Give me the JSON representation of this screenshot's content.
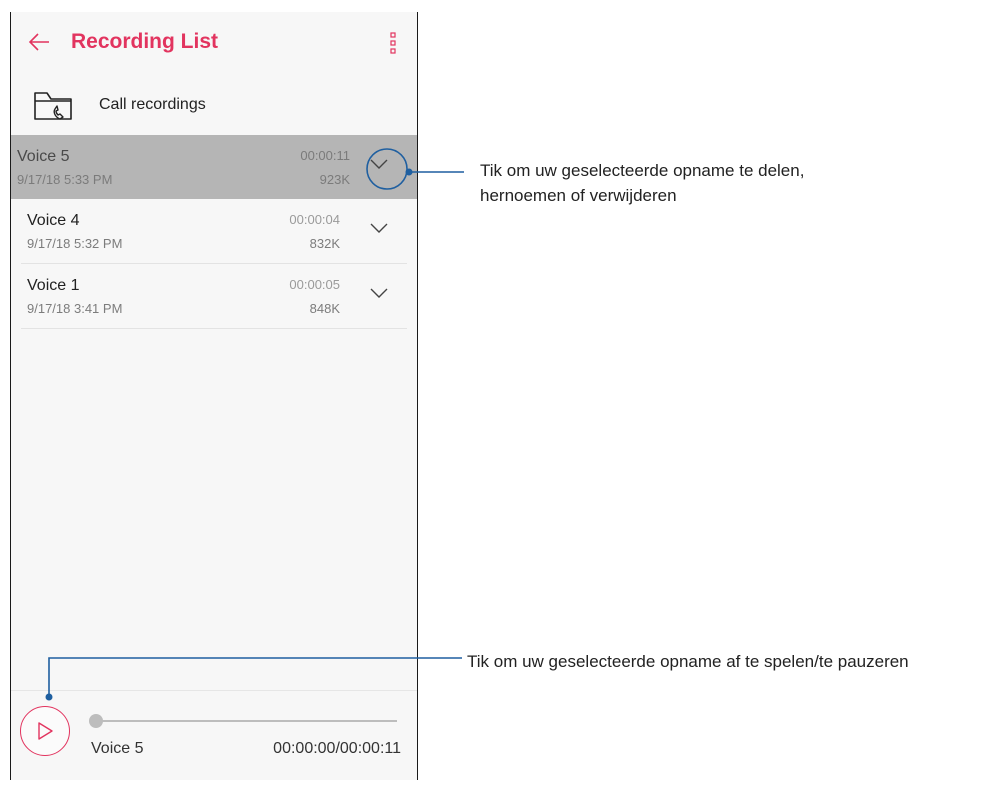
{
  "header": {
    "title": "Recording List"
  },
  "folder": {
    "label": "Call recordings"
  },
  "recordings": [
    {
      "name": "Voice 5",
      "date": "9/17/18 5:33 PM",
      "duration": "00:00:11",
      "size": "923K",
      "selected": true
    },
    {
      "name": "Voice 4",
      "date": "9/17/18 5:32 PM",
      "duration": "00:00:04",
      "size": "832K",
      "selected": false
    },
    {
      "name": "Voice 1",
      "date": "9/17/18 3:41 PM",
      "duration": "00:00:05",
      "size": "848K",
      "selected": false
    }
  ],
  "player": {
    "track_name": "Voice 5",
    "time": "00:00:00/00:00:11",
    "progress": 0
  },
  "annotations": {
    "options_line1": "Tik om uw geselecteerde opname te delen,",
    "options_line2": "hernoemen of verwijderen",
    "play": "Tik om uw geselecteerde opname af te spelen/te pauzeren"
  },
  "colors": {
    "accent": "#e2345f",
    "callout": "#1f5fa0",
    "selected_row": "#b5b5b5"
  },
  "icons": {
    "back": "arrow-left-icon",
    "menu": "more-vert-icon",
    "folder": "folder-phone-icon",
    "expand": "chevron-down-icon",
    "play": "play-icon"
  }
}
